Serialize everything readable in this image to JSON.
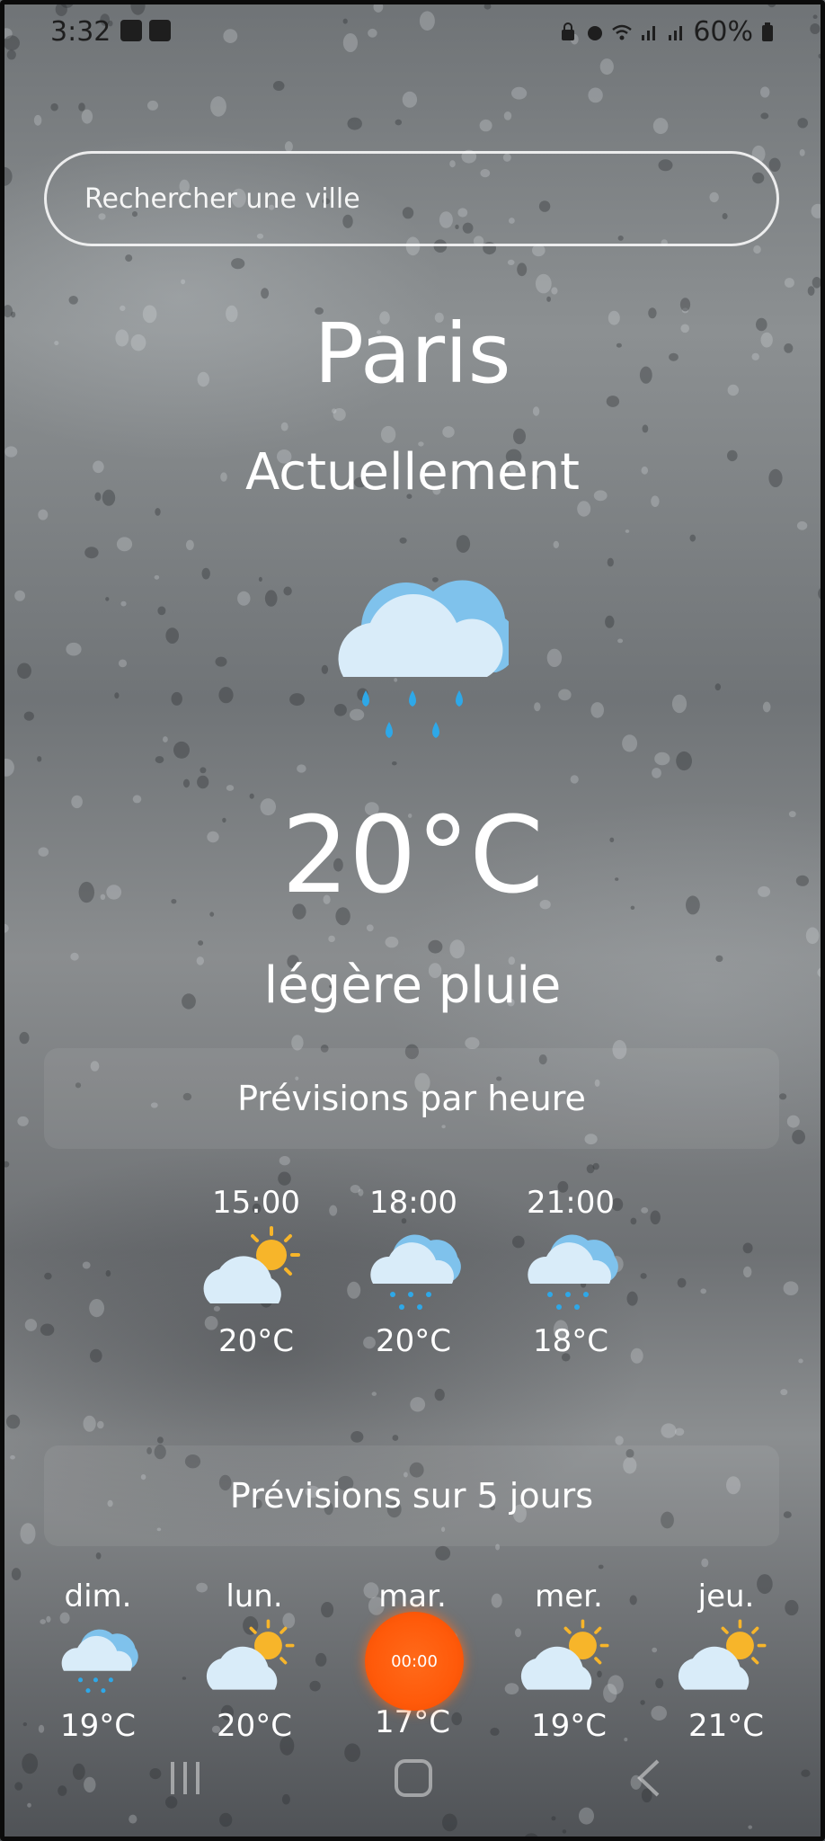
{
  "status_bar": {
    "time": "3:32",
    "battery": "60%"
  },
  "search": {
    "placeholder": "Rechercher une ville",
    "icon": "none"
  },
  "current": {
    "city": "Paris",
    "label": "Actuellement",
    "icon": "rain-cloud-icon",
    "temperature": "20°C",
    "description": "légère pluie"
  },
  "hourly": {
    "title": "Prévisions par heure",
    "items": [
      {
        "time": "15:00",
        "icon": "sun-cloud-icon",
        "temp": "20°C"
      },
      {
        "time": "18:00",
        "icon": "rain-cloud-icon",
        "temp": "20°C"
      },
      {
        "time": "21:00",
        "icon": "rain-cloud-icon",
        "temp": "18°C"
      }
    ]
  },
  "daily": {
    "title": "Prévisions sur 5 jours",
    "items": [
      {
        "day": "dim.",
        "icon": "rain-cloud-icon",
        "temp": "19°C"
      },
      {
        "day": "lun.",
        "icon": "sun-cloud-icon",
        "temp": "20°C"
      },
      {
        "day": "mar.",
        "icon": "loading-spinner-icon",
        "temp": "17°C",
        "overlay": "00:00"
      },
      {
        "day": "mer.",
        "icon": "sun-cloud-icon",
        "temp": "19°C"
      },
      {
        "day": "jeu.",
        "icon": "sun-cloud-icon",
        "temp": "21°C"
      }
    ]
  },
  "colors": {
    "accent_orange": "#ff5a0a",
    "cloud_light": "#d9ecf9",
    "cloud_blue": "#7fc2ec",
    "raindrop": "#2ea8e8",
    "sun": "#f7b52a"
  }
}
